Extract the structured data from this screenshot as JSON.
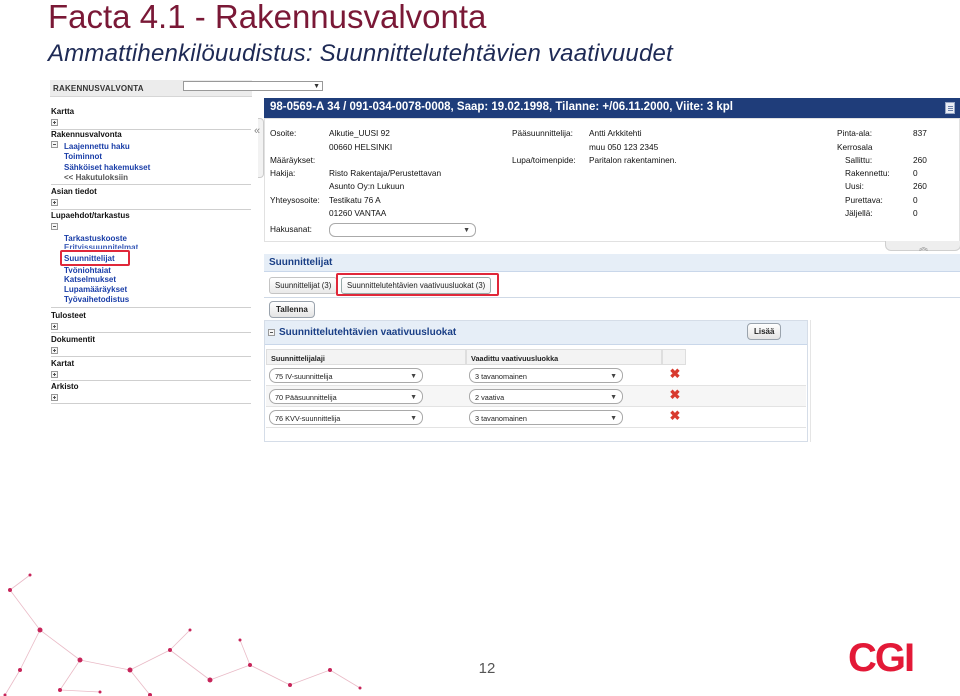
{
  "slide": {
    "title": "Facta 4.1 - Rakennusvalvonta",
    "subtitle": "Ammattihenkilöuudistus: Suunnittelutehtävien vaativuudet",
    "page_number": "12",
    "logo_text": "CGI",
    "brand_color": "#e31937"
  },
  "nav": {
    "header": "RAKENNUSVALVONTA",
    "sections": {
      "kartta": "Kartta",
      "rakennusvalvonta": "Rakennusvalvonta",
      "asian_tiedot": "Asian tiedot",
      "lupaehdot": "Lupaehdot/tarkastus",
      "tulosteet": "Tulosteet",
      "dokumentit": "Dokumentit",
      "kartat": "Kartat",
      "arkisto": "Arkisto"
    },
    "rakennusvalvonta_items": [
      "Laajennettu haku",
      "Toiminnot",
      "Sähköiset hakemukset",
      "<< Hakutuloksiin"
    ],
    "lupaehdot_items": [
      "Tarkastuskooste",
      "Erityissuunnitelmat",
      "Suunnittelijat",
      "Työnjohtajat",
      "Katselmukset",
      "Lupamääräykset",
      "Työvaihetodistus"
    ]
  },
  "case_header": {
    "title": "98-0569-A 34 / 091-034-0078-0008, Saap: 19.02.1998, Tilanne: +/06.11.2000, Viite: 3 kpl"
  },
  "info": {
    "osoite_label": "Osoite:",
    "osoite_value": "Alkutie_UUSI 92",
    "postal": "00660 HELSINKI",
    "maaraykset_label": "Määräykset:",
    "hakija_label": "Hakija:",
    "hakija_value": "Risto Rakentaja/Perustettavan",
    "hakija_value2": "Asunto Oy:n Lukuun",
    "yhteysosoite_label": "Yhteysosoite:",
    "yhteysosoite_value": "Testikatu 76 A",
    "yhteysosoite_postal": "01260 VANTAA",
    "hakusanat_label": "Hakusanat:",
    "paasuunnittelija_label": "Pääsuunnittelija:",
    "paasuunnittelija_value": "Antti Arkkitehti",
    "paasuunnittelija_phone": "muu 050 123 2345",
    "lupa_label": "Lupa/toimenpide:",
    "lupa_value": "Paritalon rakentaminen.",
    "pinta_ala_label": "Pinta-ala:",
    "pinta_ala_value": "837",
    "kerrosala_label": "Kerrosala",
    "sallittu_label": "Sallittu:",
    "sallittu_value": "260",
    "rakennettu_label": "Rakennettu:",
    "rakennettu_value": "0",
    "uusi_label": "Uusi:",
    "uusi_value": "260",
    "purettava_label": "Purettava:",
    "purettava_value": "0",
    "jaljella_label": "Jäljellä:",
    "jaljella_value": "0"
  },
  "suunnittelijat": {
    "section_title": "Suunnittelijat",
    "tabs": [
      "Suunnittelijat (3)",
      "Suunnittelutehtävien vaativuusluokat (3)"
    ],
    "save_label": "Tallenna",
    "sub_title": "Suunnittelutehtävien vaativuusluokat",
    "add_label": "Lisää",
    "col_type": "Suunnittelijalaji",
    "col_class": "Vaadittu vaativuusluokka",
    "rows": [
      {
        "type": "75   IV-suunnittelija",
        "class": "3   tavanomainen"
      },
      {
        "type": "70   Pääsuunnittelija",
        "class": "2   vaativa"
      },
      {
        "type": "76   KVV-suunnittelija",
        "class": "3   tavanomainen"
      }
    ]
  }
}
